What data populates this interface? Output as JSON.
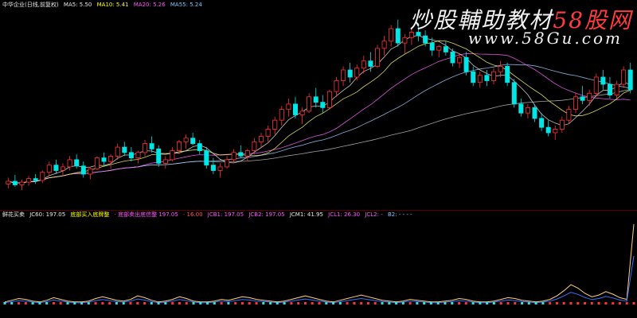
{
  "main_panel": {
    "legend": {
      "title": "中华企业(日线,前复权)",
      "items": [
        {
          "label": "MA5: 5.50",
          "color": "#e8e8e8"
        },
        {
          "label": "MA10: 5.41",
          "color": "#ffff00"
        },
        {
          "label": "MA20: 5.26",
          "color": "#ff55ff"
        },
        {
          "label": "MA55: 5.24",
          "color": "#7ec8ff"
        }
      ]
    },
    "watermark": {
      "text": "炒股輔助教材",
      "brand": "58股网",
      "url": "www.58Gu.com"
    },
    "colors": {
      "up": "#ff3333",
      "down": "#00e5e5",
      "ma5": "#e8e8e8",
      "ma10": "#ffff66",
      "ma20": "#ff66ff",
      "ma55": "#9ecbff",
      "ma_long": "#bfbfbf"
    }
  },
  "indicator_panel": {
    "legend": {
      "title": "鲜花买卖",
      "items": [
        {
          "label": "JC60: 197.05",
          "color": "#e8e8e8"
        },
        {
          "label": "底部买入底牌整",
          "color": "#ffff00"
        },
        {
          "label": "· 底部卖出底信整 197.05",
          "color": "#ff55ff"
        },
        {
          "label": "· 16.00",
          "color": "#ff5555"
        },
        {
          "label": "JCB1: 197.05",
          "color": "#ff55ff"
        },
        {
          "label": "JCB2: 197.05",
          "color": "#ff55ff"
        },
        {
          "label": "JCM1: 41.95",
          "color": "#e8e8e8"
        },
        {
          "label": "JCL1: 26.30",
          "color": "#ff55ff"
        },
        {
          "label": "JCL2: -",
          "color": "#ff55ff"
        },
        {
          "label": "B2: - - - -",
          "color": "#7ec8ff"
        }
      ]
    }
  },
  "chart_data": {
    "type": "candlestick",
    "candles": [
      [
        4.55,
        4.62,
        4.5,
        4.58
      ],
      [
        4.58,
        4.65,
        4.52,
        4.54
      ],
      [
        4.54,
        4.6,
        4.48,
        4.57
      ],
      [
        4.57,
        4.64,
        4.53,
        4.61
      ],
      [
        4.61,
        4.66,
        4.55,
        4.59
      ],
      [
        4.59,
        4.7,
        4.56,
        4.68
      ],
      [
        4.68,
        4.8,
        4.64,
        4.76
      ],
      [
        4.76,
        4.82,
        4.66,
        4.7
      ],
      [
        4.7,
        4.78,
        4.64,
        4.74
      ],
      [
        4.74,
        4.86,
        4.7,
        4.82
      ],
      [
        4.82,
        4.88,
        4.72,
        4.75
      ],
      [
        4.75,
        4.8,
        4.62,
        4.66
      ],
      [
        4.66,
        4.74,
        4.6,
        4.72
      ],
      [
        4.72,
        4.86,
        4.7,
        4.84
      ],
      [
        4.84,
        4.9,
        4.76,
        4.8
      ],
      [
        4.8,
        4.88,
        4.72,
        4.86
      ],
      [
        4.86,
        5.0,
        4.82,
        4.96
      ],
      [
        4.96,
        5.02,
        4.86,
        4.9
      ],
      [
        4.9,
        4.96,
        4.8,
        4.84
      ],
      [
        4.84,
        4.92,
        4.78,
        4.9
      ],
      [
        4.9,
        5.04,
        4.86,
        5.0
      ],
      [
        5.0,
        5.08,
        4.9,
        4.94
      ],
      [
        4.94,
        4.98,
        4.74,
        4.78
      ],
      [
        4.78,
        4.86,
        4.72,
        4.82
      ],
      [
        4.82,
        4.96,
        4.8,
        4.92
      ],
      [
        4.92,
        5.04,
        4.88,
        5.02
      ],
      [
        5.02,
        5.1,
        4.94,
        5.06
      ],
      [
        5.06,
        5.12,
        4.98,
        5.0
      ],
      [
        5.0,
        5.04,
        4.88,
        4.92
      ],
      [
        4.92,
        4.96,
        4.72,
        4.76
      ],
      [
        4.76,
        4.84,
        4.66,
        4.7
      ],
      [
        4.7,
        4.78,
        4.62,
        4.74
      ],
      [
        4.74,
        4.86,
        4.72,
        4.82
      ],
      [
        4.82,
        4.94,
        4.78,
        4.9
      ],
      [
        4.9,
        4.98,
        4.84,
        4.86
      ],
      [
        4.86,
        4.94,
        4.8,
        4.92
      ],
      [
        4.92,
        5.06,
        4.88,
        5.02
      ],
      [
        5.02,
        5.12,
        4.96,
        5.08
      ],
      [
        5.08,
        5.2,
        5.02,
        5.16
      ],
      [
        5.16,
        5.3,
        5.1,
        5.26
      ],
      [
        5.26,
        5.42,
        5.2,
        5.38
      ],
      [
        5.38,
        5.5,
        5.3,
        5.44
      ],
      [
        5.44,
        5.52,
        5.28,
        5.32
      ],
      [
        5.32,
        5.4,
        5.22,
        5.36
      ],
      [
        5.36,
        5.56,
        5.34,
        5.52
      ],
      [
        5.52,
        5.62,
        5.4,
        5.46
      ],
      [
        5.46,
        5.54,
        5.34,
        5.4
      ],
      [
        5.4,
        5.6,
        5.38,
        5.58
      ],
      [
        5.58,
        5.74,
        5.52,
        5.7
      ],
      [
        5.7,
        5.86,
        5.64,
        5.82
      ],
      [
        5.82,
        5.9,
        5.68,
        5.74
      ],
      [
        5.74,
        5.88,
        5.7,
        5.84
      ],
      [
        5.84,
        5.98,
        5.78,
        5.92
      ],
      [
        5.92,
        6.02,
        5.8,
        5.86
      ],
      [
        5.86,
        6.1,
        5.84,
        6.06
      ],
      [
        6.06,
        6.2,
        5.98,
        6.14
      ],
      [
        6.14,
        6.32,
        6.08,
        6.28
      ],
      [
        6.28,
        6.38,
        6.08,
        6.12
      ],
      [
        6.12,
        6.22,
        6.0,
        6.18
      ],
      [
        6.18,
        6.3,
        6.1,
        6.24
      ],
      [
        6.24,
        6.34,
        6.14,
        6.2
      ],
      [
        6.2,
        6.26,
        6.08,
        6.12
      ],
      [
        6.12,
        6.18,
        5.98,
        6.04
      ],
      [
        6.04,
        6.1,
        5.96,
        6.08
      ],
      [
        6.08,
        6.14,
        5.98,
        6.02
      ],
      [
        6.02,
        6.06,
        5.86,
        5.9
      ],
      [
        5.9,
        6.0,
        5.84,
        5.96
      ],
      [
        5.96,
        6.02,
        5.76,
        5.8
      ],
      [
        5.8,
        5.86,
        5.64,
        5.68
      ],
      [
        5.68,
        5.8,
        5.62,
        5.76
      ],
      [
        5.76,
        5.82,
        5.64,
        5.7
      ],
      [
        5.7,
        5.84,
        5.66,
        5.8
      ],
      [
        5.8,
        5.92,
        5.74,
        5.86
      ],
      [
        5.86,
        5.9,
        5.64,
        5.68
      ],
      [
        5.68,
        5.72,
        5.4,
        5.44
      ],
      [
        5.44,
        5.5,
        5.3,
        5.34
      ],
      [
        5.34,
        5.44,
        5.28,
        5.4
      ],
      [
        5.4,
        5.44,
        5.24,
        5.28
      ],
      [
        5.28,
        5.34,
        5.14,
        5.18
      ],
      [
        5.18,
        5.26,
        5.08,
        5.12
      ],
      [
        5.12,
        5.2,
        5.04,
        5.16
      ],
      [
        5.16,
        5.3,
        5.12,
        5.26
      ],
      [
        5.26,
        5.42,
        5.22,
        5.38
      ],
      [
        5.38,
        5.56,
        5.34,
        5.52
      ],
      [
        5.52,
        5.64,
        5.44,
        5.48
      ],
      [
        5.48,
        5.6,
        5.42,
        5.56
      ],
      [
        5.56,
        5.78,
        5.52,
        5.74
      ],
      [
        5.74,
        5.82,
        5.6,
        5.66
      ],
      [
        5.66,
        5.74,
        5.5,
        5.54
      ],
      [
        5.54,
        5.7,
        5.5,
        5.66
      ],
      [
        5.66,
        5.86,
        5.62,
        5.82
      ],
      [
        5.82,
        5.9,
        5.56,
        5.6
      ]
    ],
    "indicator": [
      2,
      4,
      6,
      5,
      3,
      2,
      4,
      7,
      5,
      3,
      2,
      2,
      3,
      6,
      8,
      6,
      4,
      3,
      5,
      9,
      7,
      4,
      2,
      3,
      5,
      8,
      6,
      3,
      2,
      2,
      3,
      5,
      4,
      6,
      8,
      7,
      5,
      4,
      3,
      2,
      3,
      5,
      7,
      9,
      7,
      5,
      3,
      2,
      4,
      6,
      8,
      10,
      8,
      6,
      4,
      3,
      2,
      3,
      5,
      4,
      3,
      2,
      2,
      3,
      4,
      6,
      5,
      3,
      2,
      2,
      3,
      5,
      7,
      6,
      4,
      3,
      2,
      3,
      5,
      9,
      15,
      22,
      18,
      12,
      8,
      10,
      14,
      11,
      7,
      5,
      92
    ],
    "xlabel": "",
    "ylabel": ""
  }
}
